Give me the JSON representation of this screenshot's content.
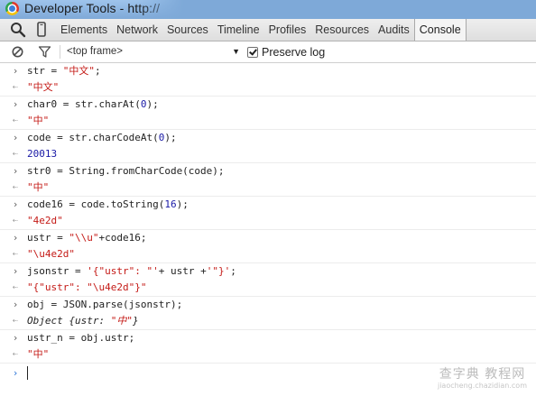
{
  "window": {
    "title": "Developer Tools - http://"
  },
  "toolbar": {
    "tabs": [
      "Elements",
      "Network",
      "Sources",
      "Timeline",
      "Profiles",
      "Resources",
      "Audits",
      "Console"
    ],
    "active_tab": "Console"
  },
  "console_toolbar": {
    "frame_select": "<top frame>",
    "preserve_log_label": "Preserve log",
    "preserve_log_checked": true
  },
  "entries": [
    {
      "input": [
        "str = ",
        "\"中文\"",
        ";"
      ],
      "output": "\"中文\"",
      "output_type": "string"
    },
    {
      "input": [
        "char0 = str.charAt(",
        "0",
        ");"
      ],
      "output": "\"中\"",
      "output_type": "string"
    },
    {
      "input": [
        "code = str.charCodeAt(",
        "0",
        ");"
      ],
      "output": "20013",
      "output_type": "number"
    },
    {
      "input": [
        "str0 = String.fromCharCode(code);"
      ],
      "output": "\"中\"",
      "output_type": "string"
    },
    {
      "input": [
        "code16 = code.toString(",
        "16",
        ");"
      ],
      "output": "\"4e2d\"",
      "output_type": "string"
    },
    {
      "input": [
        "ustr = ",
        "\"\\\\u\"",
        "+code16;"
      ],
      "output": "\"\\u4e2d\"",
      "output_type": "string"
    },
    {
      "input": [
        "jsonstr = ",
        "'{\"ustr\": \"'",
        "+ ustr +",
        "'\"}'",
        ";"
      ],
      "output": "\"{\"ustr\": \"\\u4e2d\"}\"",
      "output_type": "string"
    },
    {
      "input": [
        "obj = JSON.parse(jsonstr);"
      ],
      "output_prefix": "Object {ustr: ",
      "output_value": "\"中\"",
      "output_suffix": "}",
      "output_type": "object"
    },
    {
      "input": [
        "ustr_n = obj.ustr;"
      ],
      "output": "\"中\"",
      "output_type": "string"
    }
  ],
  "watermark": {
    "main": "查字典 教程网",
    "sub": "jiaocheng.chazidian.com"
  },
  "colors": {
    "string": "#c41a16",
    "number": "#1a1aa6",
    "prompt_active": "#2a73d6",
    "titlebar": "#8fb6e2"
  },
  "icons": {
    "prompt": "chevron-right-icon",
    "result": "result-arrow-icon",
    "clear": "clear-console-icon",
    "filter": "filter-icon",
    "search": "search-icon",
    "device": "device-mode-icon"
  }
}
